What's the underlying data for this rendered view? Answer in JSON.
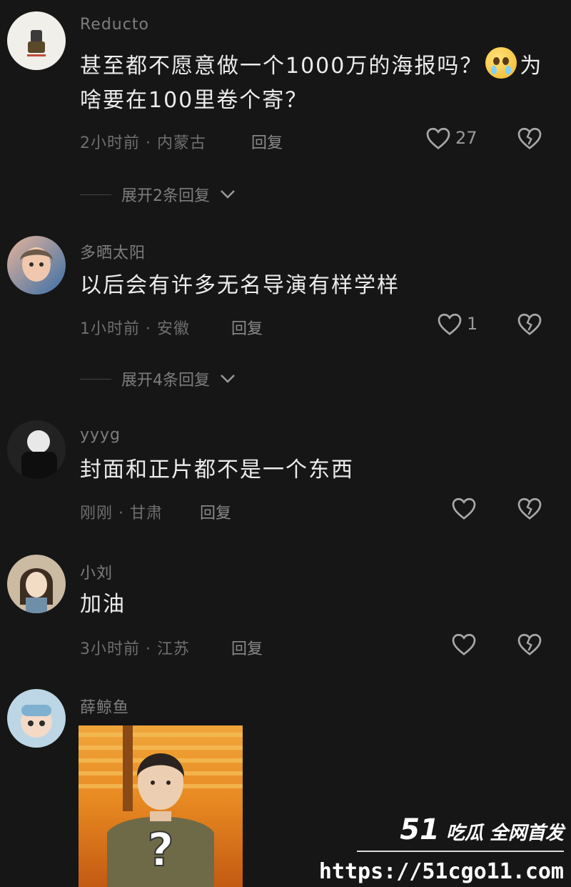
{
  "comments": [
    {
      "username": "Reducto",
      "text_before_emoji": "甚至都不愿意做一个1000万的海报吗？",
      "emoji": "crying-face",
      "text_after_emoji_line1": "为",
      "text_line2": "啥要在100里卷个寄？",
      "meta": "2小时前 · 内蒙古",
      "reply_label": "回复",
      "likes": "27",
      "expand_label": "展开2条回复",
      "avatar_colors": [
        "#f1efe9",
        "#3b3b3b"
      ]
    },
    {
      "username": "多晒太阳",
      "text": "以后会有许多无名导演有样学样",
      "meta": "1小时前 · 安徽",
      "reply_label": "回复",
      "likes": "1",
      "expand_label": "展开4条回复",
      "avatar_colors": [
        "#d79a7a",
        "#3a6fa8"
      ]
    },
    {
      "username": "yyyg",
      "text": "封面和正片都不是一个东西",
      "meta": "刚刚 · 甘肃",
      "reply_label": "回复",
      "likes": "",
      "avatar_colors": [
        "#2a2a2a",
        "#e8e8e8"
      ]
    },
    {
      "username": "小刘",
      "text": "加油",
      "meta": "3小时前 · 江苏",
      "reply_label": "回复",
      "likes": "",
      "avatar_colors": [
        "#c9b79d",
        "#4b3a2d"
      ]
    },
    {
      "username": "薛鲸鱼",
      "avatar_colors": [
        "#bcd6e6",
        "#f3d9c6"
      ],
      "image_symbol": "?"
    }
  ],
  "watermark": {
    "brand_num": "51",
    "brand_text": "吃瓜 全网首发",
    "url": "https://51cgo11.com"
  },
  "colors": {
    "background": "#161616",
    "text": "#ececec",
    "muted": "#7d7d7d"
  }
}
